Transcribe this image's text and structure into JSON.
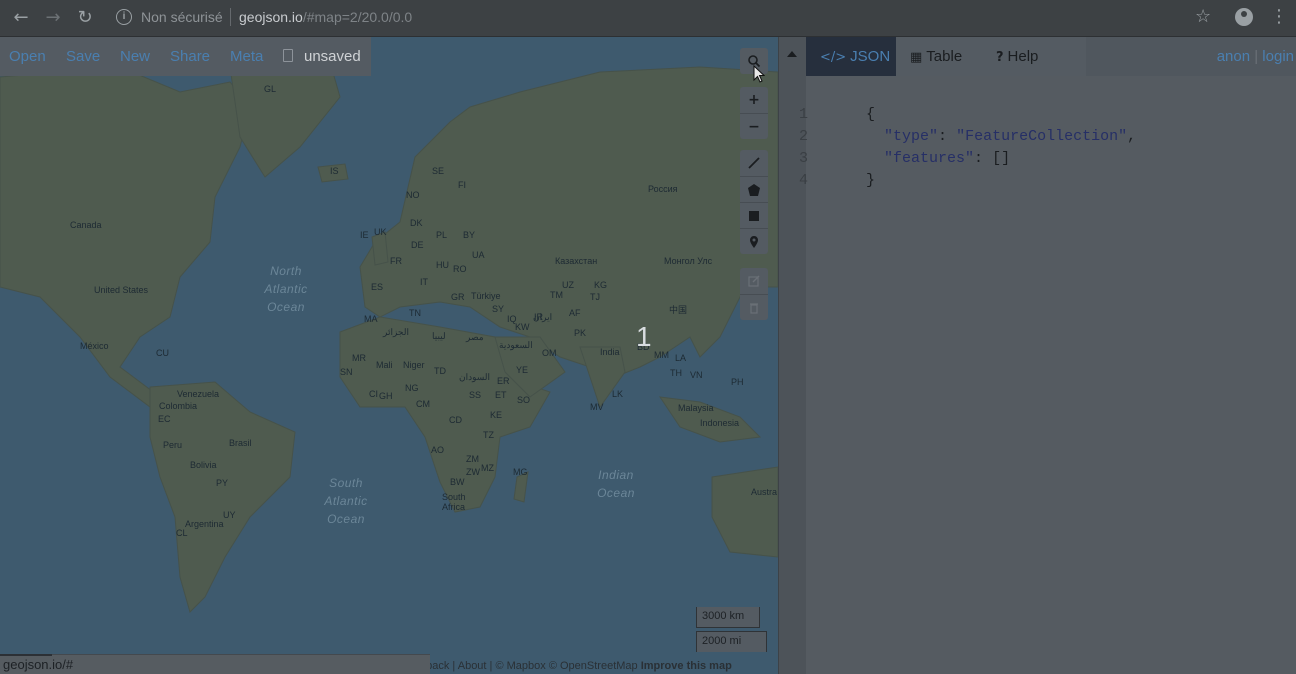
{
  "browser": {
    "back_icon": "arrow-left-icon",
    "forward_icon": "arrow-right-icon",
    "reload_icon": "reload-icon",
    "security_label": "Non sécurisé",
    "url_host": "geojson.io",
    "url_path": "/#map=2/20.0/0.0"
  },
  "menu": {
    "items": [
      "Open",
      "Save",
      "New",
      "Share",
      "Meta"
    ],
    "file_status": "unsaved"
  },
  "map": {
    "cluster_count": "1",
    "labels": [
      "GL",
      "IS",
      "NO",
      "SE",
      "FI",
      "DK",
      "IE",
      "UK",
      "DE",
      "PL",
      "BY",
      "UA",
      "FR",
      "HU",
      "RO",
      "ES",
      "IT",
      "GR",
      "Türkiye",
      "MA",
      "TN",
      "SY",
      "IQ",
      "IR",
      "KW",
      "AF",
      "PK",
      "TM",
      "UZ",
      "KG",
      "TJ",
      "Canada",
      "United States",
      "México",
      "CU",
      "Venezuela",
      "Colombia",
      "EC",
      "Peru",
      "Brasil",
      "Bolivia",
      "PY",
      "UY",
      "Argentina",
      "CL",
      "Россия",
      "Казахстан",
      "Монгол Улс",
      "中国",
      "India",
      "BD",
      "MM",
      "LA",
      "TH",
      "VN",
      "PH",
      "Malaysia",
      "Indonesia",
      "LK",
      "MV",
      "OM",
      "YE",
      "السعودية",
      "مصر",
      "ليبيا",
      "الجزائر",
      "MR",
      "SN",
      "Mali",
      "Niger",
      "TD",
      "CI",
      "GH",
      "NG",
      "CM",
      "السودان",
      "SS",
      "ET",
      "SO",
      "KE",
      "CD",
      "TZ",
      "AO",
      "ZM",
      "MZ",
      "ZW",
      "BW",
      "MG",
      "South Africa",
      "Austra",
      "ER",
      "ايران"
    ],
    "oceans": {
      "north_atlantic": [
        "North",
        "Atlantic",
        "Ocean"
      ],
      "south_atlantic": [
        "South",
        "Atlantic",
        "Ocean"
      ],
      "indian": [
        "Indian",
        "Ocean"
      ]
    },
    "controls": {
      "search_icon": "search-icon",
      "zoom_in": "+",
      "zoom_out": "−",
      "draw_line_icon": "draw-line-icon",
      "draw_polygon_icon": "draw-polygon-icon",
      "draw_rectangle_icon": "draw-rectangle-icon",
      "draw_marker_icon": "marker-icon",
      "edit_icon": "edit-icon",
      "delete_icon": "trash-icon"
    },
    "scale_km": "3000 km",
    "scale_mi": "2000 mi",
    "attribution": {
      "feedback": "dback",
      "about": "About",
      "mapbox": "© Mapbox",
      "osm": "© OpenStreetMap",
      "improve": "Improve this map"
    },
    "status_url": "geojson.io/#"
  },
  "panel": {
    "tabs": [
      {
        "label": "JSON",
        "icon": "code-icon"
      },
      {
        "label": "Table",
        "icon": "table-icon"
      },
      {
        "label": "Help",
        "icon": "question-icon"
      }
    ],
    "user": "anon",
    "login": "login",
    "code_lines": [
      {
        "num": "1",
        "text": "{"
      },
      {
        "num": "2",
        "key": "\"type\"",
        "sep": ": ",
        "value": "\"FeatureCollection\"",
        "end": ","
      },
      {
        "num": "3",
        "key": "\"features\"",
        "sep": ": ",
        "value": "[]",
        "end": ""
      },
      {
        "num": "4",
        "text": "}"
      }
    ]
  }
}
